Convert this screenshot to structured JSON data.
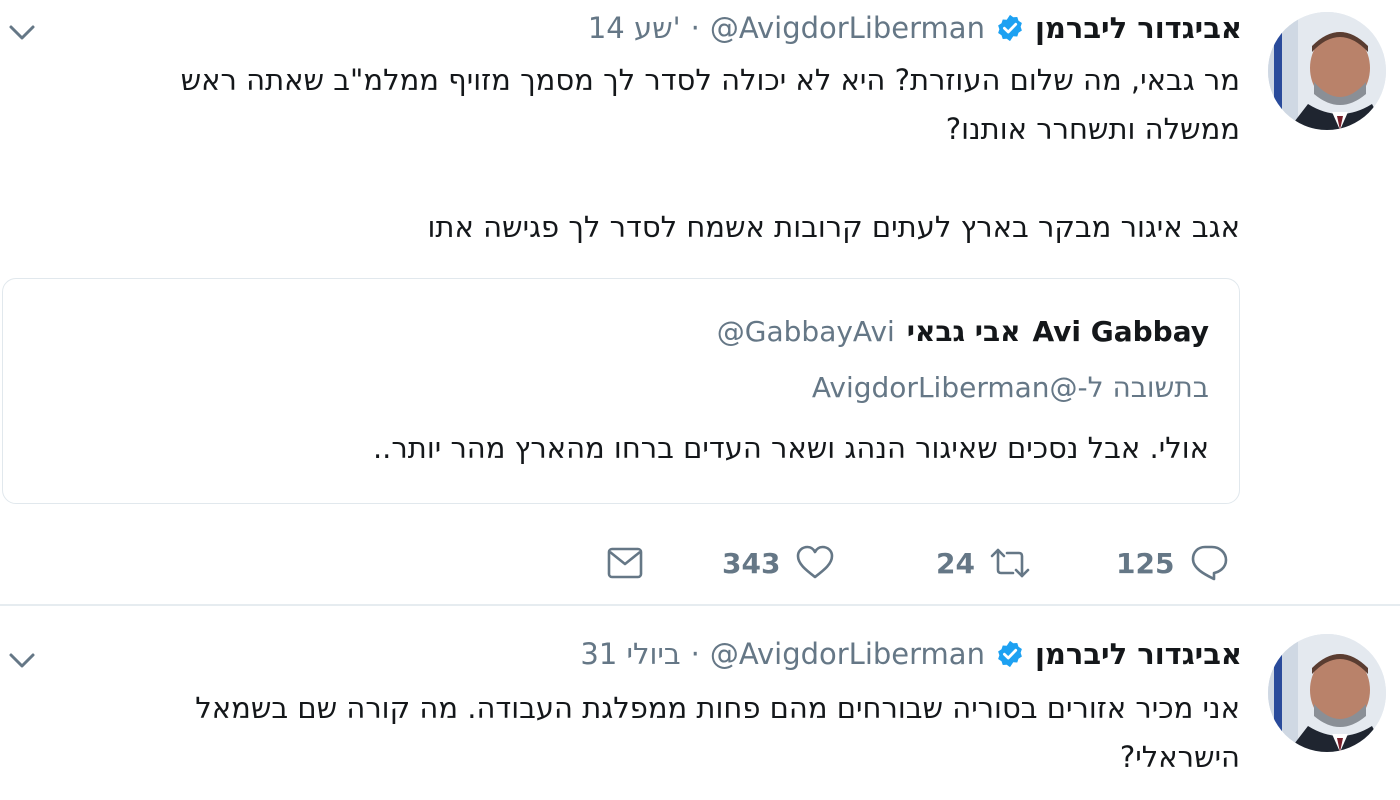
{
  "tweets": [
    {
      "author": {
        "name": "אביגדור ליברמן",
        "handle": "@AvigdorLiberman",
        "verified": true
      },
      "separator": "·",
      "time": "14 שע'",
      "text": "מר גבאי, מה שלום העוזרת? היא לא יכולה לסדר לך מסמך מזויף ממלמ\"ב שאתה ראש\nממשלה ותשחרר אותנו?\n\nאגב איגור מבקר בארץ לעתים קרובות אשמח לסדר לך פגישה אתו",
      "quote": {
        "name_en": "Avi Gabbay",
        "name_he": "אבי גבאי",
        "handle": "@GabbayAvi",
        "reply_to": "בתשובה ל-@AvigdorLiberman",
        "text": "אולי.  אבל נסכים שאיגור הנהג ושאר העדים ברחו מהארץ מהר יותר.."
      },
      "actions": {
        "replies": "125",
        "retweets": "24",
        "likes": "343"
      }
    },
    {
      "author": {
        "name": "אביגדור ליברמן",
        "handle": "@AvigdorLiberman",
        "verified": true
      },
      "separator": "·",
      "time": "31 ביולי",
      "text": "אני מכיר אזורים בסוריה שבורחים מהם פחות ממפלגת העבודה. מה קורה שם בשמאל\nהישראלי?"
    }
  ],
  "colors": {
    "verified": "#1da1f2",
    "secondary_text": "#657786",
    "primary_text": "#14171a",
    "border": "#e1e8ed"
  },
  "icons": {
    "reply": "reply-icon",
    "retweet": "retweet-icon",
    "like": "heart-icon",
    "dm": "envelope-icon",
    "menu": "chevron-down-icon",
    "verified": "verified-badge-icon"
  }
}
